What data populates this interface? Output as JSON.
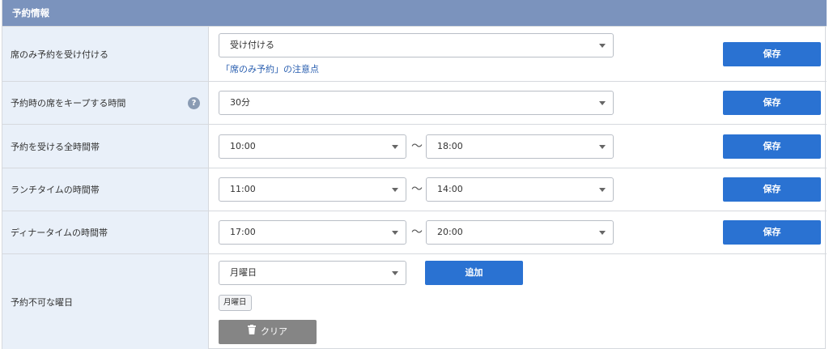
{
  "header": {
    "title": "予約情報"
  },
  "rows": [
    {
      "label": "席のみ予約を受け付ける",
      "select_value": "受け付ける",
      "link": "「席のみ予約」の注意点",
      "save_label": "保存"
    },
    {
      "label": "予約時の席をキープする時間",
      "help_icon": "?",
      "select_value": "30分",
      "save_label": "保存"
    },
    {
      "label": "予約を受ける全時間帯",
      "start": "10:00",
      "separator": "〜",
      "end": "18:00",
      "save_label": "保存"
    },
    {
      "label": "ランチタイムの時間帯",
      "start": "11:00",
      "separator": "〜",
      "end": "14:00",
      "save_label": "保存"
    },
    {
      "label": "ディナータイムの時間帯",
      "start": "17:00",
      "separator": "〜",
      "end": "20:00",
      "save_label": "保存"
    },
    {
      "label": "予約不可な曜日",
      "select_value": "月曜日",
      "add_label": "追加",
      "chips": [
        "月曜日"
      ],
      "clear_label": "クリア"
    }
  ],
  "colors": {
    "header_bg": "#7b93bd",
    "label_bg": "#e9f0f9",
    "primary_button": "#2a72d2",
    "clear_button": "#858585",
    "link": "#2a5fb0"
  },
  "icons": [
    "question-icon",
    "caret-down-icon",
    "trash-icon"
  ]
}
